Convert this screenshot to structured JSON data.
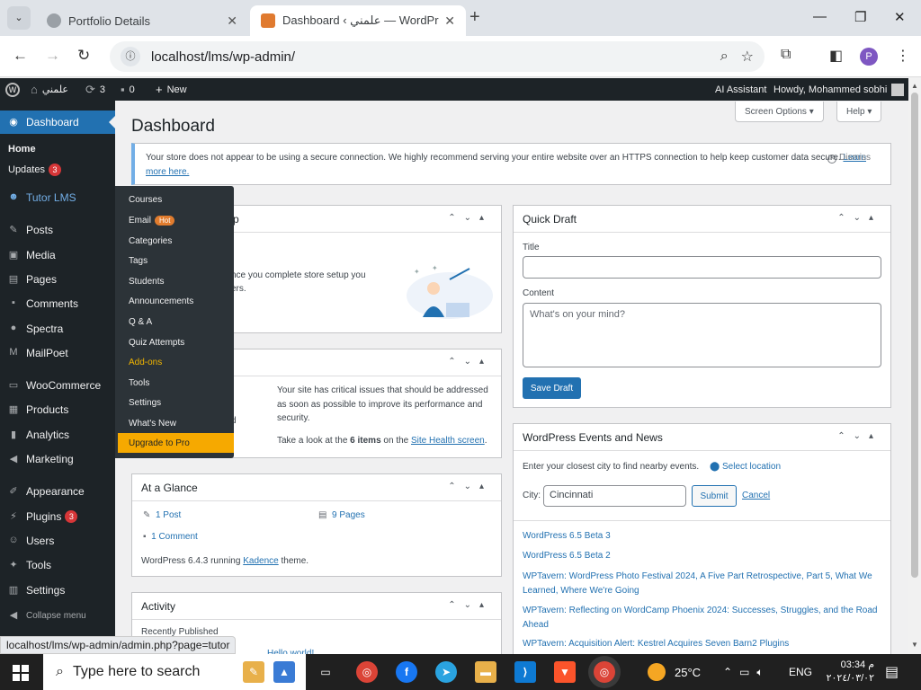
{
  "browser": {
    "tabs": [
      {
        "title": "Portfolio Details",
        "active": false
      },
      {
        "title": "Dashboard ‹ علمني — WordPre",
        "active": true
      }
    ],
    "url": "localhost/lms/wp-admin/",
    "profile_initial": "P"
  },
  "adminbar": {
    "site_name": "علمني",
    "updates_count": "3",
    "comments_count": "0",
    "new_label": "New",
    "ai_label": "AI Assistant",
    "howdy": "Howdy, Mohammed sobhi"
  },
  "sidebar": {
    "dashboard": "Dashboard",
    "home": "Home",
    "updates": "Updates",
    "updates_badge": "3",
    "tutor": "Tutor LMS",
    "posts": "Posts",
    "media": "Media",
    "pages": "Pages",
    "comments": "Comments",
    "spectra": "Spectra",
    "mailpoet": "MailPoet",
    "woocommerce": "WooCommerce",
    "products": "Products",
    "analytics": "Analytics",
    "marketing": "Marketing",
    "appearance": "Appearance",
    "plugins": "Plugins",
    "plugins_badge": "3",
    "users": "Users",
    "tools": "Tools",
    "settings": "Settings",
    "collapse": "Collapse menu"
  },
  "flyout": {
    "courses": "Courses",
    "email": "Email",
    "hot": "Hot",
    "categories": "Categories",
    "tags": "Tags",
    "students": "Students",
    "announcements": "Announcements",
    "qa": "Q & A",
    "quiz": "Quiz Attempts",
    "addons": "Add-ons",
    "tools": "Tools",
    "settings": "Settings",
    "whats_new": "What's New",
    "upgrade": "Upgrade to Pro"
  },
  "main": {
    "title": "Dashboard",
    "screen_options": "Screen Options",
    "help": "Help",
    "notice_text": "Your store does not appear to be using a secure connection. We highly recommend serving your entire website over an HTTPS connection to help keep customer data secure.",
    "notice_link": "Learn more here.",
    "dismiss": "Dismiss",
    "setup_title_frag": "p",
    "setup_text_a": "nce you complete store setup you",
    "setup_text_b": "ers.",
    "health_text": "Your site has critical issues that should be addressed as soon as possible to improve its performance and security.",
    "health_frag": "d",
    "health_look_pre": "Take a look at the",
    "health_items": "6 items",
    "health_on": "on the",
    "health_link": "Site Health screen",
    "glance_title": "At a Glance",
    "glance_posts": "1 Post",
    "glance_pages": "9 Pages",
    "glance_comments": "1 Comment",
    "glance_version_pre": "WordPress 6.4.3 running",
    "glance_theme": "Kadence",
    "glance_version_post": "theme.",
    "activity_title": "Activity",
    "activity_recent": "Recently Published",
    "activity_hello": "Hello world!",
    "qd_title": "Quick Draft",
    "qd_title_label": "Title",
    "qd_content_label": "Content",
    "qd_placeholder": "What's on your mind?",
    "qd_save": "Save Draft",
    "events_title": "WordPress Events and News",
    "events_intro": "Enter your closest city to find nearby events.",
    "events_select": "Select location",
    "events_city_label": "City:",
    "events_city_value": "Cincinnati",
    "events_submit": "Submit",
    "events_cancel": "Cancel",
    "news": [
      "WordPress 6.5 Beta 3",
      "WordPress 6.5 Beta 2",
      "WPTavern: WordPress Photo Festival 2024, A Five Part Retrospective, Part 5, What We Learned, Where We're Going",
      "WPTavern: Reflecting on WordCamp Phoenix 2024: Successes, Struggles, and the Road Ahead",
      "WPTavern: Acquisition Alert: Kestrel Acquires Seven Barn2 Plugins"
    ]
  },
  "status_url": "localhost/lms/wp-admin/admin.php?page=tutor",
  "taskbar": {
    "search_placeholder": "Type here to search",
    "temperature": "25°C",
    "lang": "ENG",
    "time": "03:34 م",
    "date": "٢٠٢٤/٠٣/٠٢"
  },
  "colors": {
    "wp_blue": "#2271b1",
    "admin_dark": "#1d2327",
    "upgrade_orange": "#f6a900"
  }
}
